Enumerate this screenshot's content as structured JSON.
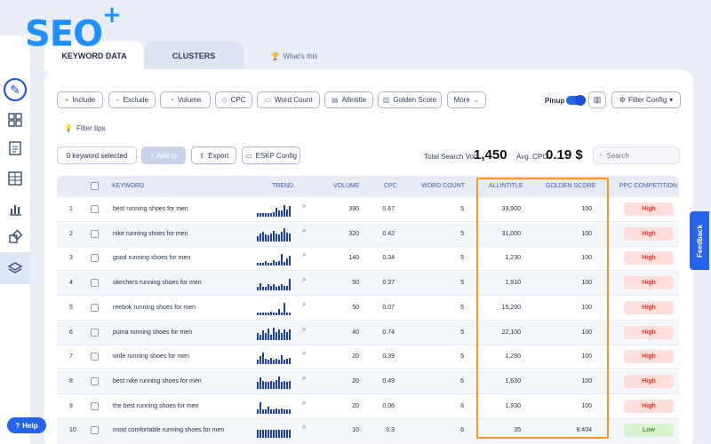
{
  "logo": {
    "text": "SEO",
    "plus": "+"
  },
  "tabs": {
    "keyword_data": "KEYWORD DATA",
    "clusters": "CLUSTERS",
    "whats_this": "What's this"
  },
  "toolbar": {
    "include": "Include",
    "exclude": "Exclude",
    "volume": "Volume",
    "cpc": "CPC",
    "word_count": "Word Count",
    "allintitle": "Allintitle",
    "golden_score": "Golden Score",
    "more": "More",
    "pinup": "Pinup",
    "filter_config": "Filter Config",
    "filter_tips": "Filter tips"
  },
  "actions": {
    "selected": "0 keyword selected",
    "add_to": "Add to",
    "export": "Export",
    "eskp_config": "ESKP Config",
    "search_placeholder": "Search"
  },
  "stats": {
    "total_label": "Total Search Vol:",
    "total_value": "1,450",
    "cpc_label": "Avg. CPC:",
    "cpc_value": "0.19 $"
  },
  "columns": {
    "keyword": "KEYWORD",
    "trend": "TREND",
    "volume": "VOLUME",
    "cpc": "CPC",
    "word_count": "WORD COUNT",
    "allintitle": "ALLINTITLE",
    "golden_score": "GOLDEN SCORE",
    "ppc": "PPC COMPETITION"
  },
  "rows": [
    {
      "n": "1",
      "keyword": "best running shoes for men",
      "volume": "390",
      "cpc": "0.67",
      "wc": "5",
      "allintitle": "33,900",
      "golden": "100",
      "ppc": "High",
      "trend": [
        0.25,
        0.25,
        0.25,
        0.25,
        0.25,
        0.3,
        0.35,
        0.7,
        0.45,
        0.5,
        0.9,
        0.55,
        0.8
      ]
    },
    {
      "n": "2",
      "keyword": "nike running shoes for men",
      "volume": "320",
      "cpc": "0.42",
      "wc": "5",
      "allintitle": "31,000",
      "golden": "100",
      "ppc": "High",
      "trend": [
        0.4,
        0.55,
        0.7,
        0.5,
        0.45,
        0.6,
        0.8,
        0.55,
        0.5,
        0.7,
        0.95,
        0.65,
        0.6
      ]
    },
    {
      "n": "3",
      "keyword": "good running shoes for men",
      "volume": "140",
      "cpc": "0.34",
      "wc": "5",
      "allintitle": "1,230",
      "golden": "100",
      "ppc": "High",
      "trend": [
        0.2,
        0.2,
        0.2,
        0.35,
        0.2,
        0.2,
        0.45,
        0.3,
        0.35,
        0.9,
        0.3,
        0.55,
        0.75
      ]
    },
    {
      "n": "4",
      "keyword": "skechers running shoes for men",
      "volume": "50",
      "cpc": "0.37",
      "wc": "5",
      "allintitle": "1,910",
      "golden": "100",
      "ppc": "High",
      "trend": [
        0.3,
        0.55,
        0.3,
        0.3,
        0.45,
        0.35,
        0.45,
        0.3,
        0.35,
        0.5,
        0.35,
        0.35,
        0.85
      ]
    },
    {
      "n": "5",
      "keyword": "reebok running shoes for men",
      "volume": "50",
      "cpc": "0.07",
      "wc": "5",
      "allintitle": "15,200",
      "golden": "100",
      "ppc": "High",
      "trend": [
        0.2,
        0.2,
        0.2,
        0.2,
        0.2,
        0.25,
        0.2,
        0.2,
        0.45,
        0.2,
        0.95,
        0.2,
        0.2
      ]
    },
    {
      "n": "6",
      "keyword": "puma running shoes for men",
      "volume": "40",
      "cpc": "0.74",
      "wc": "5",
      "allintitle": "22,100",
      "golden": "100",
      "ppc": "High",
      "trend": [
        0.5,
        0.35,
        0.7,
        0.5,
        0.85,
        0.4,
        0.9,
        0.55,
        0.75,
        0.5,
        0.8,
        0.55,
        0.75
      ]
    },
    {
      "n": "7",
      "keyword": "wide running shoes for men",
      "volume": "20",
      "cpc": "0.39",
      "wc": "5",
      "allintitle": "1,280",
      "golden": "100",
      "ppc": "High",
      "trend": [
        0.35,
        0.6,
        0.9,
        0.4,
        0.35,
        0.5,
        0.35,
        0.4,
        0.35,
        0.7,
        0.35,
        0.4,
        0.5
      ]
    },
    {
      "n": "8",
      "keyword": "best nike running shoes for men",
      "volume": "20",
      "cpc": "0.49",
      "wc": "6",
      "allintitle": "1,630",
      "golden": "100",
      "ppc": "High",
      "trend": [
        0.5,
        0.85,
        0.6,
        0.5,
        0.55,
        0.6,
        0.5,
        0.65,
        0.9,
        0.55,
        0.6,
        0.5,
        0.6
      ]
    },
    {
      "n": "9",
      "keyword": "the best running shoes for men",
      "volume": "20",
      "cpc": "0.06",
      "wc": "6",
      "allintitle": "1,930",
      "golden": "100",
      "ppc": "High",
      "trend": [
        0.3,
        0.85,
        0.3,
        0.3,
        0.5,
        0.3,
        0.3,
        0.4,
        0.3,
        0.35,
        0.3,
        0.3,
        0.3
      ]
    },
    {
      "n": "10",
      "keyword": "most comfortable running shoes for men",
      "volume": "10",
      "cpc": "0.3",
      "wc": "6",
      "allintitle": "35",
      "golden": "6.404",
      "ppc": "Low",
      "trend": [
        0.6,
        0.6,
        0.6,
        0.6,
        0.6,
        0.6,
        0.6,
        0.6,
        0.6,
        0.6,
        0.6,
        0.6,
        0.6
      ]
    }
  ],
  "feedback": "Feedback",
  "help": "Help",
  "colors": {
    "accent": "#2563eb",
    "highlight": "#f39a1e",
    "high_badge": "#fde0dc",
    "low_badge": "#d8f5d0"
  }
}
